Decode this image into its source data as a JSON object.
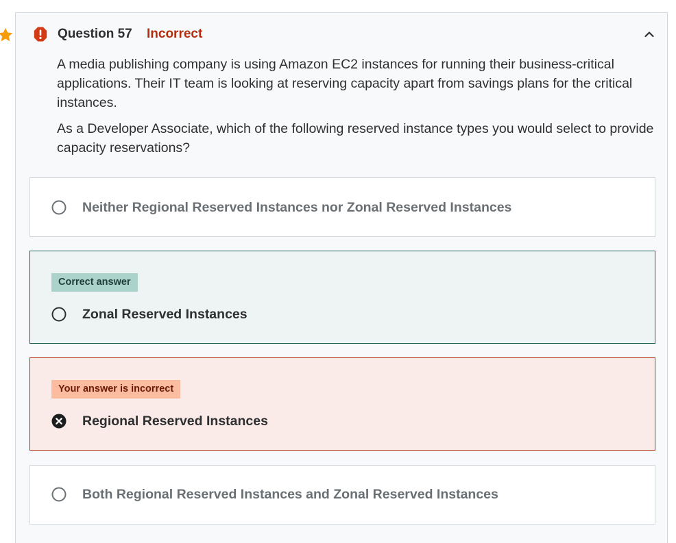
{
  "question": {
    "title": "Question 57",
    "status": "Incorrect",
    "paragraphs": [
      "A media publishing company is using Amazon EC2 instances for running their business-critical applications. Their IT team is looking at reserving capacity apart from savings plans for the critical instances.",
      "As a Developer Associate, which of the following reserved instance types you would select to provide capacity reservations?"
    ]
  },
  "options": [
    {
      "label": "Neither Regional Reserved Instances nor Zonal Reserved Instances",
      "state": "neutral"
    },
    {
      "label": "Zonal Reserved Instances",
      "state": "correct",
      "badge": "Correct answer"
    },
    {
      "label": "Regional Reserved Instances",
      "state": "incorrect",
      "badge": "Your answer is incorrect"
    },
    {
      "label": "Both Regional Reserved Instances and Zonal Reserved Instances",
      "state": "neutral"
    }
  ],
  "icons": {
    "star": "star-icon",
    "alert": "alert-icon",
    "collapse": "chevron-up-icon",
    "radio": "radio-empty-icon",
    "wrong": "x-circle-icon"
  },
  "colors": {
    "incorrect": "#b32d0f",
    "correct_border": "#1e6055",
    "star": "#f69c08",
    "alert": "#d13b16"
  }
}
